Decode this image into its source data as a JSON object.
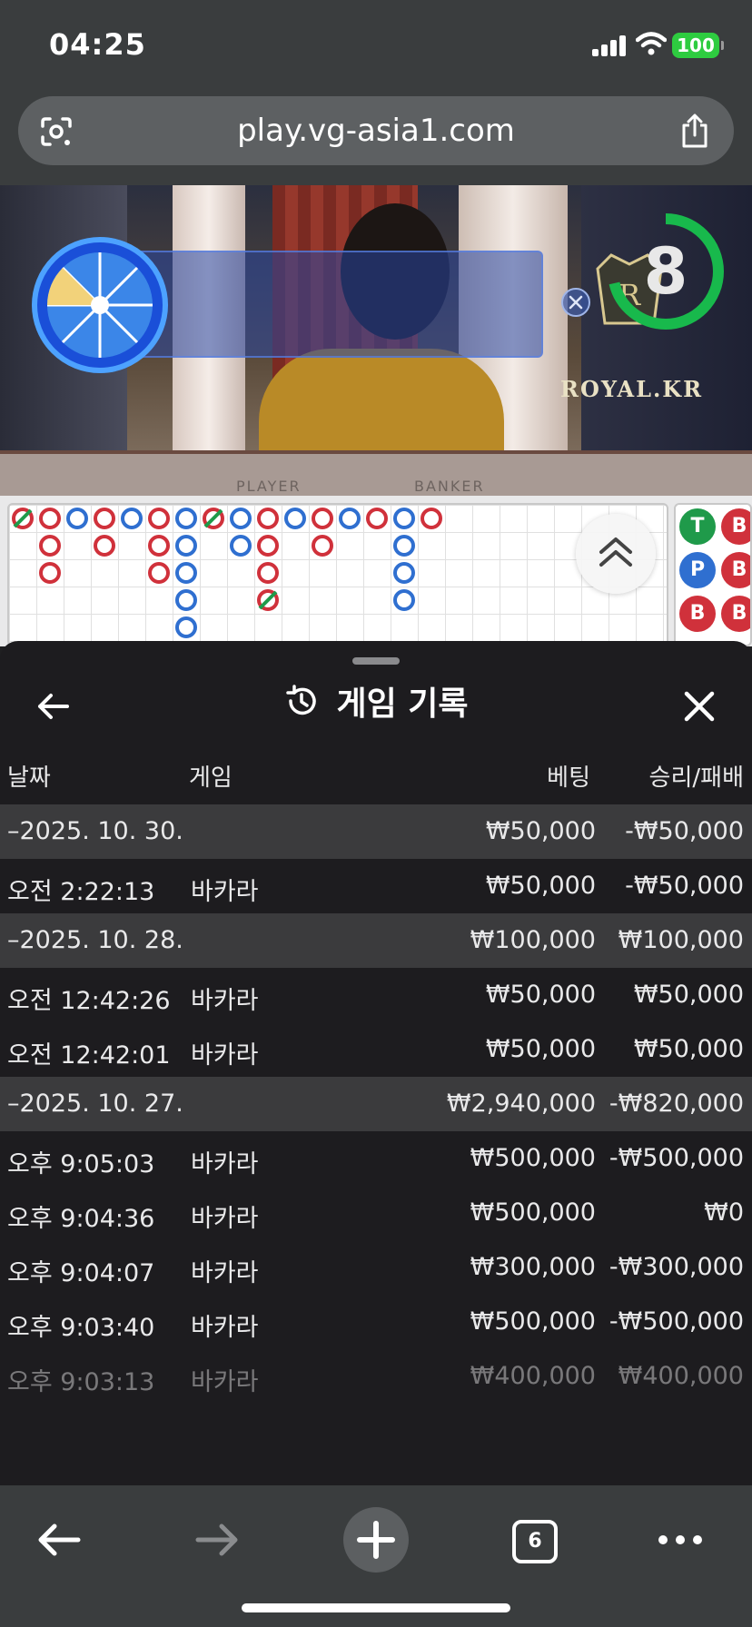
{
  "status": {
    "time": "04:25",
    "battery": "100"
  },
  "browser": {
    "url": "play.vg-asia1.com",
    "tab_count": "6"
  },
  "video": {
    "countdown": "8",
    "logo_text": "ROYAL.KR",
    "felt_left": "PLAYER",
    "felt_right": "BANKER"
  },
  "side_road": {
    "beads": [
      "T",
      "B",
      "P",
      "B",
      "B",
      "B"
    ]
  },
  "history": {
    "title": "게임 기록",
    "columns": {
      "date": "날짜",
      "game": "게임",
      "bet": "베팅",
      "winloss": "승리/패배"
    },
    "rows": [
      {
        "type": "group",
        "date": "–2025. 10. 30.",
        "game": "",
        "bet": "₩50,000",
        "winloss": "-₩50,000"
      },
      {
        "type": "item",
        "date": "오전 2:22:13",
        "game": "바카라",
        "bet": "₩50,000",
        "winloss": "-₩50,000"
      },
      {
        "type": "group",
        "date": "–2025. 10. 28.",
        "game": "",
        "bet": "₩100,000",
        "winloss": "₩100,000"
      },
      {
        "type": "item",
        "date": "오전 12:42:26",
        "game": "바카라",
        "bet": "₩50,000",
        "winloss": "₩50,000"
      },
      {
        "type": "item",
        "date": "오전 12:42:01",
        "game": "바카라",
        "bet": "₩50,000",
        "winloss": "₩50,000"
      },
      {
        "type": "group",
        "date": "–2025. 10. 27.",
        "game": "",
        "bet": "₩2,940,000",
        "winloss": "-₩820,000"
      },
      {
        "type": "item",
        "date": "오후 9:05:03",
        "game": "바카라",
        "bet": "₩500,000",
        "winloss": "-₩500,000"
      },
      {
        "type": "item",
        "date": "오후 9:04:36",
        "game": "바카라",
        "bet": "₩500,000",
        "winloss": "₩0"
      },
      {
        "type": "item",
        "date": "오후 9:04:07",
        "game": "바카라",
        "bet": "₩300,000",
        "winloss": "-₩300,000"
      },
      {
        "type": "item",
        "date": "오후 9:03:40",
        "game": "바카라",
        "bet": "₩500,000",
        "winloss": "-₩500,000"
      },
      {
        "type": "item",
        "date": "오후 9:03:13",
        "game": "바카라",
        "bet": "₩400,000",
        "winloss": "₩400,000"
      }
    ]
  },
  "colors": {
    "banker": "#d0313b",
    "player": "#2f6fd0",
    "tie": "#1f9a4a",
    "accent_green": "#18b94c"
  }
}
